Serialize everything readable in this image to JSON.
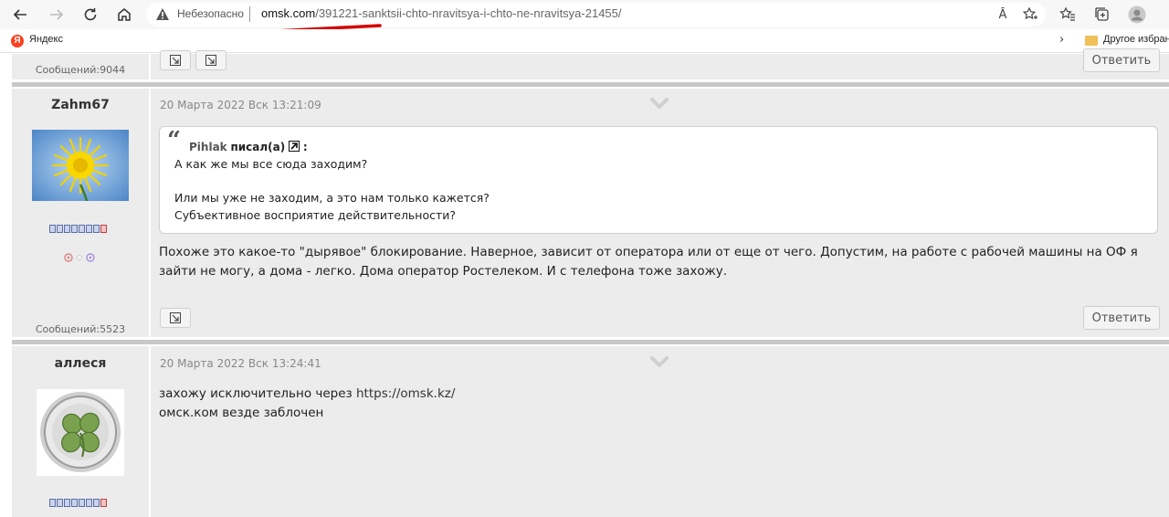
{
  "browser": {
    "address": {
      "insecure_label": "Небезопасно",
      "url_host": "omsk.com",
      "url_path": "/391221-sanktsii-chto-nravitsya-i-chto-ne-nravitsya-21455/"
    },
    "bookmarks": {
      "yandex_letter": "Я",
      "yandex_label": "Яндекс",
      "folder_label": "Другое избранное"
    },
    "reader_icon_label": "Ȃ"
  },
  "colors": {
    "accent_red": "#d40000",
    "post_background": "#ececec",
    "separator": "#c8c8c8"
  },
  "posts": [
    {
      "message_count": "Сообщений:9044",
      "reply_label": "Ответить"
    },
    {
      "username": "Zahm67",
      "date": "20 Марта 2022 Вск 13:21:09",
      "quote": {
        "author": "Pihlak",
        "wrote": "писал(а)",
        "colon": ":",
        "lines": [
          "А как же мы все сюда заходим?",
          "Или мы уже не заходим, а это нам только кажется?",
          "Субъективное восприятие действительности?"
        ]
      },
      "text": "Похоже это какое-то \"дырявое\" блокирование. Наверное, зависит от оператора или от еще от чего. Допустим, на работе с рабочей машины на ОФ я зайти не могу, а дома - легко. Дома оператор Ростелеком. И с телефона тоже захожу.",
      "message_count": "Сообщений:5523",
      "reply_label": "Ответить"
    },
    {
      "username": "аллеся",
      "date": "20 Марта 2022 Вск 13:24:41",
      "text_line1_prefix": "захожу исключительно через ",
      "text_line1_link": "https://omsk.kz/",
      "text_line2": "омск.ком везде заблочен"
    }
  ]
}
